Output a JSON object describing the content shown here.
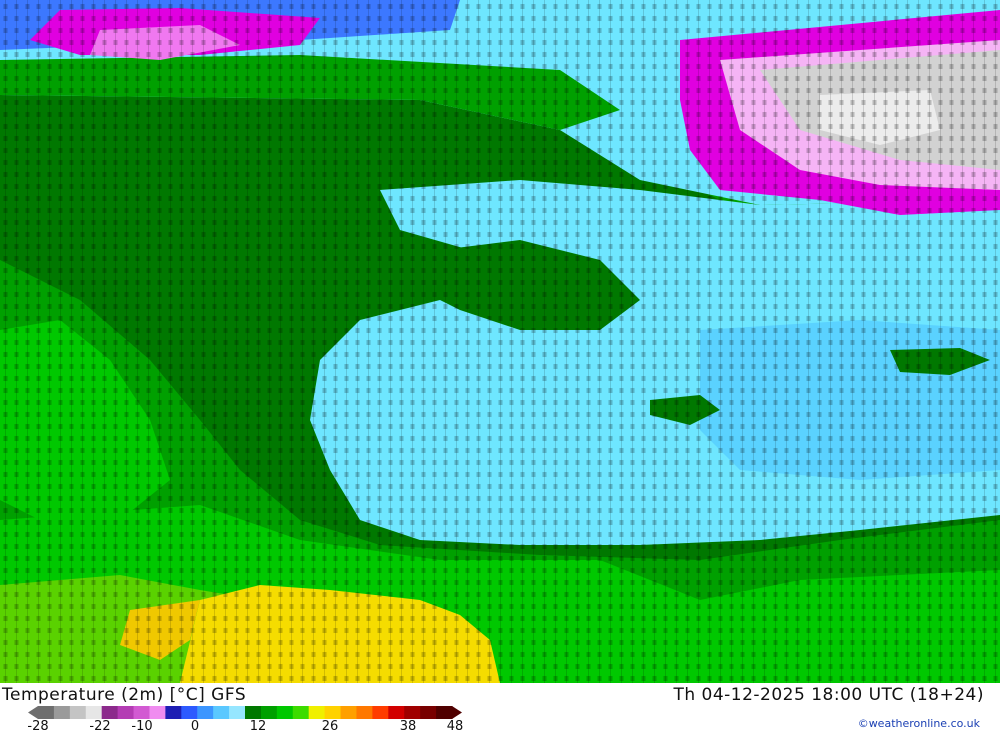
{
  "map": {
    "title": "Temperature (2m) [°C] GFS",
    "datetime": "Th 04-12-2025 18:00 UTC (18+24)",
    "credit": "©weatheronline.co.uk"
  },
  "legend": {
    "ticks": [
      "-28",
      "-22",
      "-10",
      "0",
      "12",
      "26",
      "38",
      "48"
    ],
    "colors": [
      "#6e6e6e",
      "#9a9a9a",
      "#c4c4c4",
      "#e6e6e6",
      "#8c2a8c",
      "#b43cb4",
      "#d25ad2",
      "#f08cf0",
      "#1e1eb4",
      "#2d5aff",
      "#3c96ff",
      "#5ac8ff",
      "#96e6ff",
      "#007800",
      "#00a000",
      "#00c800",
      "#3cdc00",
      "#f0f000",
      "#ffd200",
      "#ffa000",
      "#ff7800",
      "#ff3c00",
      "#d20000",
      "#a00000",
      "#780000",
      "#500000"
    ]
  },
  "palette": {
    "deep_pink": "#e000e0",
    "pink": "#f078f0",
    "light_pink": "#f5b4f5",
    "grey": "#d2d2d2",
    "blue": "#3c78ff",
    "light_blue": "#5ad2ff",
    "cyan": "#6ee6ff",
    "dark_green": "#006e00",
    "green": "#00a000",
    "bright_green": "#00c800",
    "yellow_green": "#5ad200",
    "yellow": "#f5dc00",
    "gold": "#f0c800"
  }
}
